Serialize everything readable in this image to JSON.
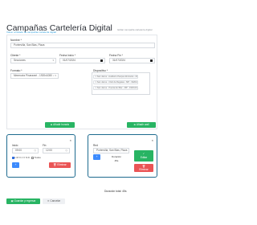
{
  "header": {
    "title": "Campañas Cartelería Digital",
    "subtitle": "Editar campaña cartelería digital",
    "back_link": "Volver al listado de campañas cartelería digital"
  },
  "form": {
    "name_label": "Nombre *",
    "name_value": "Portervilla, San Blas, Plaza",
    "client_label": "Cliente *",
    "client_value": "Secciones",
    "start_label": "Fecha Inicio *",
    "start_value": "01/07/2024",
    "end_label": "Fecha Fin *",
    "end_value": "31/07/2024",
    "format_label": "Formato *",
    "format_value": "Mmerovia Pirueaveri - 1920x1080",
    "device_label": "Dispositivo *",
    "screens": [
      "× San Janne - Auditorío Parque Almirante - MP - 1920x1080",
      "× San Janne - Club de Regatas - MP - 1920x1080",
      "× San Janne - Puerta del Mar - MP - 1920x1080"
    ]
  },
  "actions": {
    "add_schedule": "Añadir horario",
    "add_wall": "Añadir wall"
  },
  "schedule": {
    "start_label": "Inicio",
    "end_label": "Fin",
    "start_value": "09:00",
    "end_value": "12:00",
    "days": "L M X J V S D",
    "days_all": "Todos",
    "delete": "Eliminar",
    "add": "+"
  },
  "wall": {
    "label": "Red",
    "value": "Portervilla, San Blas, Plaza",
    "duration_label": "Duración",
    "duration_value": "45s",
    "save": "Editar",
    "delete": "Eliminar",
    "add": "+"
  },
  "summary": {
    "total_duration": "Duración total: 45s"
  },
  "footer": {
    "save_back": "Guardar y regresar",
    "cancel": "Cancelar"
  },
  "colors": {
    "panel_border": "#1e6b8f",
    "green": "#28b463",
    "red": "#ea5455",
    "blue": "#3d8bfd"
  }
}
